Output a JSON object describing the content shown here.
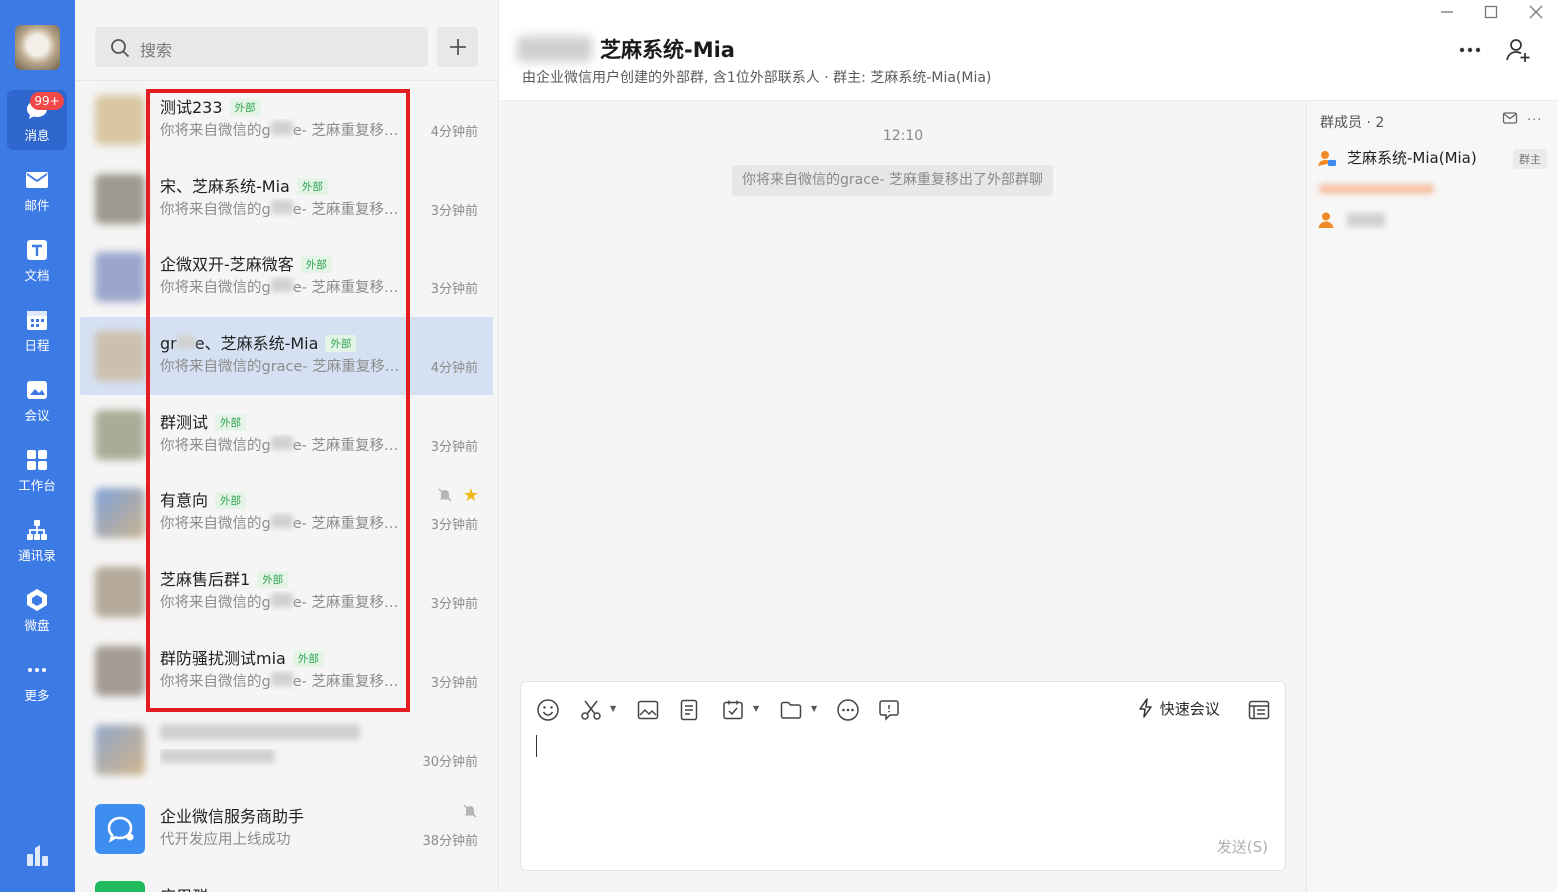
{
  "rail": {
    "badge": "99+",
    "items": [
      {
        "label": "消息"
      },
      {
        "label": "邮件"
      },
      {
        "label": "文档"
      },
      {
        "label": "日程"
      },
      {
        "label": "会议"
      },
      {
        "label": "工作台"
      },
      {
        "label": "通讯录"
      },
      {
        "label": "微盘"
      },
      {
        "label": "更多"
      }
    ]
  },
  "search": {
    "placeholder": "搜索"
  },
  "conversations": [
    {
      "name": "测试233",
      "tag": "外部",
      "preview_a": "你将来自微信的g",
      "preview_b": "e- 芝麻重复移出了外部群聊",
      "time": "4分钟前"
    },
    {
      "name": "宋、芝麻系统-Mia",
      "tag": "外部",
      "preview_a": "你将来自微信的g",
      "preview_b": "e- 芝麻重复移出了外部群聊",
      "time": "3分钟前"
    },
    {
      "name": "企微双开-芝麻微客",
      "tag": "外部",
      "preview_a": "你将来自微信的g",
      "preview_b": "e- 芝麻重复移出了外部群聊",
      "time": "3分钟前"
    },
    {
      "name_a": "gr",
      "name_b": "e、芝麻系统-Mia",
      "tag": "外部",
      "preview": "你将来自微信的grace- 芝麻重复移出了外部群聊",
      "time": "4分钟前"
    },
    {
      "name": "群测试",
      "tag": "外部",
      "preview_a": "你将来自微信的g",
      "preview_b": "e- 芝麻重复移出了外部群聊",
      "time": "3分钟前"
    },
    {
      "name": "有意向",
      "tag": "外部",
      "preview_a": "你将来自微信的g",
      "preview_b": "e- 芝麻重复移出了外部群聊",
      "time": "3分钟前"
    },
    {
      "name": "芝麻售后群1",
      "tag": "外部",
      "preview_a": "你将来自微信的g",
      "preview_b": "e- 芝麻重复移出了外部群聊",
      "time": "3分钟前"
    },
    {
      "name": "群防骚扰测试mia",
      "tag": "外部",
      "preview_a": "你将来自微信的g",
      "preview_b": "e- 芝麻重复移出了外部群聊",
      "time": "3分钟前"
    },
    {
      "time": "30分钟前"
    },
    {
      "name": "企业微信服务商助手",
      "preview": "代开发应用上线成功",
      "time": "38分钟前"
    },
    {
      "name": "应用群"
    }
  ],
  "chat": {
    "title": "芝麻系统-Mia",
    "subtitle": "由企业微信用户创建的外部群, 含1位外部联系人 · 群主: 芝麻系统-Mia(Mia)",
    "time": "12:10",
    "system_message": "你将来自微信的grace- 芝麻重复移出了外部群聊",
    "quick_meeting": "快速会议",
    "send": "发送(S)"
  },
  "members": {
    "title": "群成员 · 2",
    "owner_name": "芝麻系统-Mia(Mia)",
    "owner_tag": "群主"
  },
  "colors": {
    "rail": "#3c7be5",
    "accent": "#3c7be5",
    "badge": "#f14848",
    "ext_tag": "#2ea44f",
    "highlight": "#e31b23"
  }
}
